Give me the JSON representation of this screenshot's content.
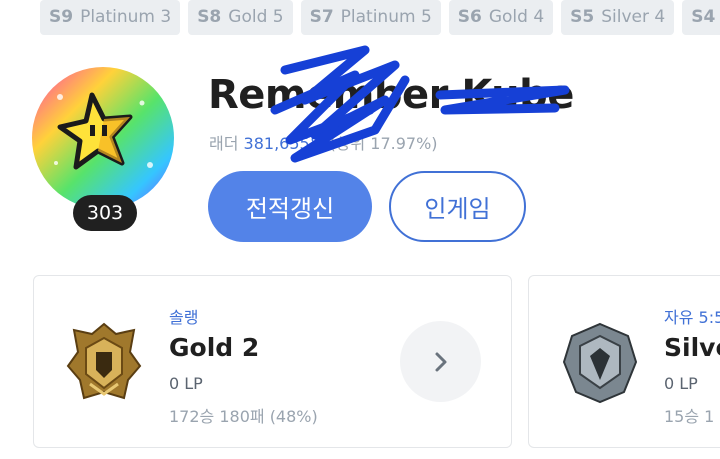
{
  "seasons": [
    {
      "id": "S9",
      "tier": "Platinum 3"
    },
    {
      "id": "S8",
      "tier": "Gold 5"
    },
    {
      "id": "S7",
      "tier": "Platinum 5"
    },
    {
      "id": "S6",
      "tier": "Gold 4"
    },
    {
      "id": "S5",
      "tier": "Silver 4"
    },
    {
      "id": "S4",
      "tier": ""
    }
  ],
  "profile": {
    "level": "303",
    "name": "Remember Kube",
    "ladder_label": "래더",
    "ladder_rank": "381,655위",
    "ladder_top": "(상위 17.97%)"
  },
  "actions": {
    "refresh_label": "전적갱신",
    "ingame_label": "인게임"
  },
  "ranks": {
    "solo": {
      "queue": "솔랭",
      "tier": "Gold 2",
      "lp": "0 LP",
      "record": "172승 180패 (48%)"
    },
    "flex": {
      "queue": "자유 5:5",
      "tier": "Silver",
      "lp": "0 LP",
      "record": "15승 1"
    }
  },
  "colors": {
    "accent": "#5383e8",
    "accent_text": "#4171d6",
    "muted": "#9aa4af",
    "pill_bg": "#ebeef1"
  }
}
